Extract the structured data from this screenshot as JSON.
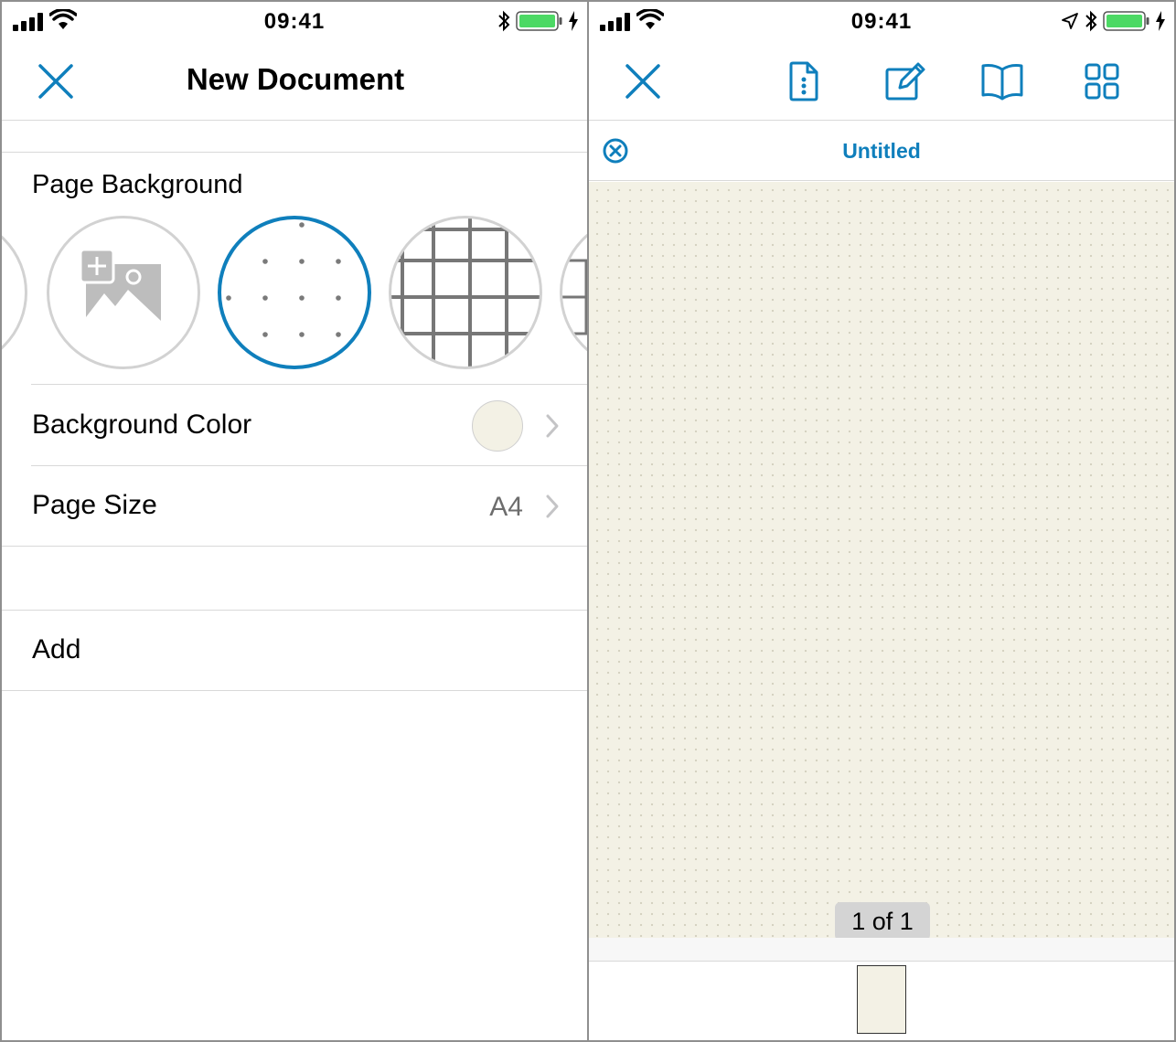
{
  "status_left": {
    "time": "09:41"
  },
  "status_right": {
    "time": "09:41"
  },
  "new_document": {
    "title": "New Document",
    "page_background_label": "Page Background",
    "backgrounds": [
      {
        "name": "partial-left",
        "selected": false
      },
      {
        "name": "custom-image",
        "selected": false
      },
      {
        "name": "dotted",
        "selected": true
      },
      {
        "name": "grid",
        "selected": false
      },
      {
        "name": "partial-right",
        "selected": false
      }
    ],
    "background_color": {
      "label": "Background Color",
      "swatch_color": "#f3f1e5"
    },
    "page_size": {
      "label": "Page Size",
      "value": "A4"
    },
    "add_label": "Add"
  },
  "viewer": {
    "document_title": "Untitled",
    "page_indicator": "1 of 1",
    "page_color": "#f3f1e5"
  },
  "colors": {
    "accent": "#0f7fbc",
    "battery": "#4cd964"
  },
  "icons": {
    "toolbar": [
      "close-icon",
      "document-info-icon",
      "edit-icon",
      "book-icon",
      "grid-view-icon"
    ]
  }
}
